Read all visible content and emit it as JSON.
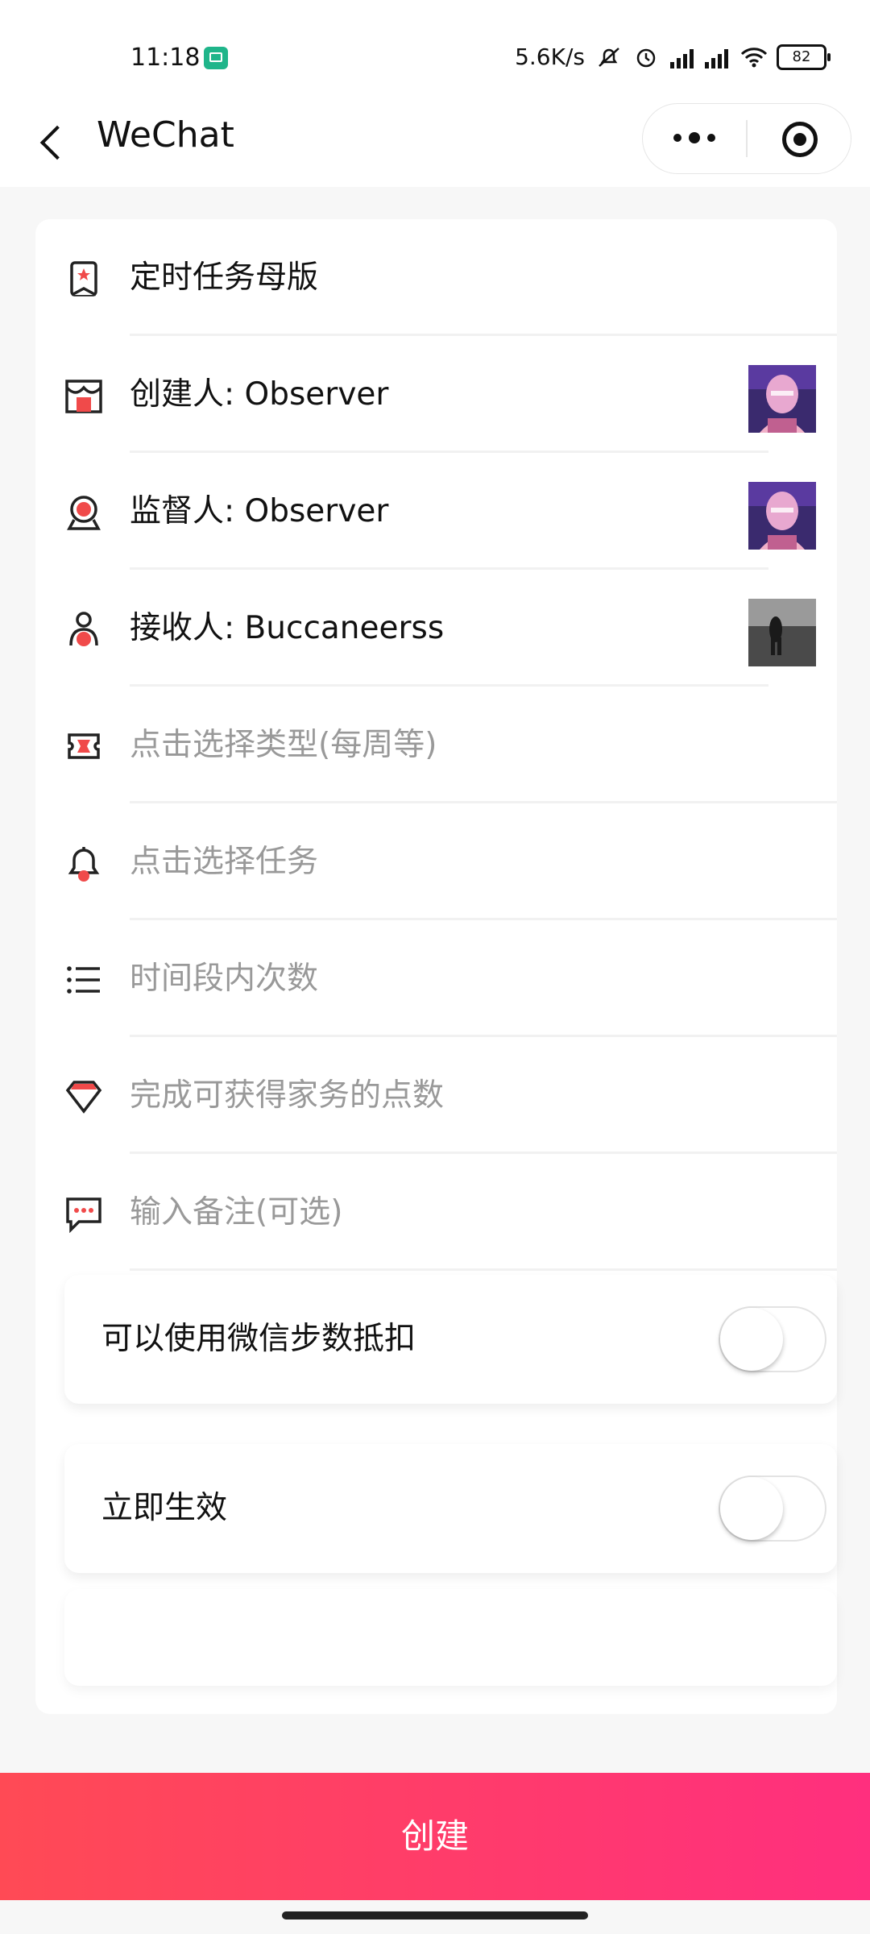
{
  "status_bar": {
    "time": "11:18",
    "speed": "5.6K/s",
    "battery": "82"
  },
  "nav": {
    "title": "WeChat"
  },
  "form": {
    "rows": [
      {
        "label": "定时任务母版",
        "icon": "bookmark-star-icon",
        "placeholder": false
      },
      {
        "label": "创建人: Observer",
        "icon": "store-icon",
        "placeholder": false
      },
      {
        "label": "监督人: Observer",
        "icon": "supervisor-icon",
        "placeholder": false
      },
      {
        "label": "接收人: Buccaneerss",
        "icon": "person-icon",
        "placeholder": false
      },
      {
        "label": "点击选择类型(每周等)",
        "icon": "ticket-icon",
        "placeholder": true
      },
      {
        "label": "点击选择任务",
        "icon": "bell-icon",
        "placeholder": true
      },
      {
        "label": "时间段内次数",
        "icon": "list-icon",
        "placeholder": true
      },
      {
        "label": "完成可获得家务的点数",
        "icon": "diamond-icon",
        "placeholder": true
      },
      {
        "label": "输入备注(可选)",
        "icon": "comment-icon",
        "placeholder": true
      }
    ],
    "toggles": [
      {
        "label": "可以使用微信步数抵扣",
        "on": false
      },
      {
        "label": "立即生效",
        "on": false
      }
    ]
  },
  "create_button": "创建",
  "colors": {
    "accent": "#ff3d6a",
    "icon_red": "#f04a4a"
  }
}
